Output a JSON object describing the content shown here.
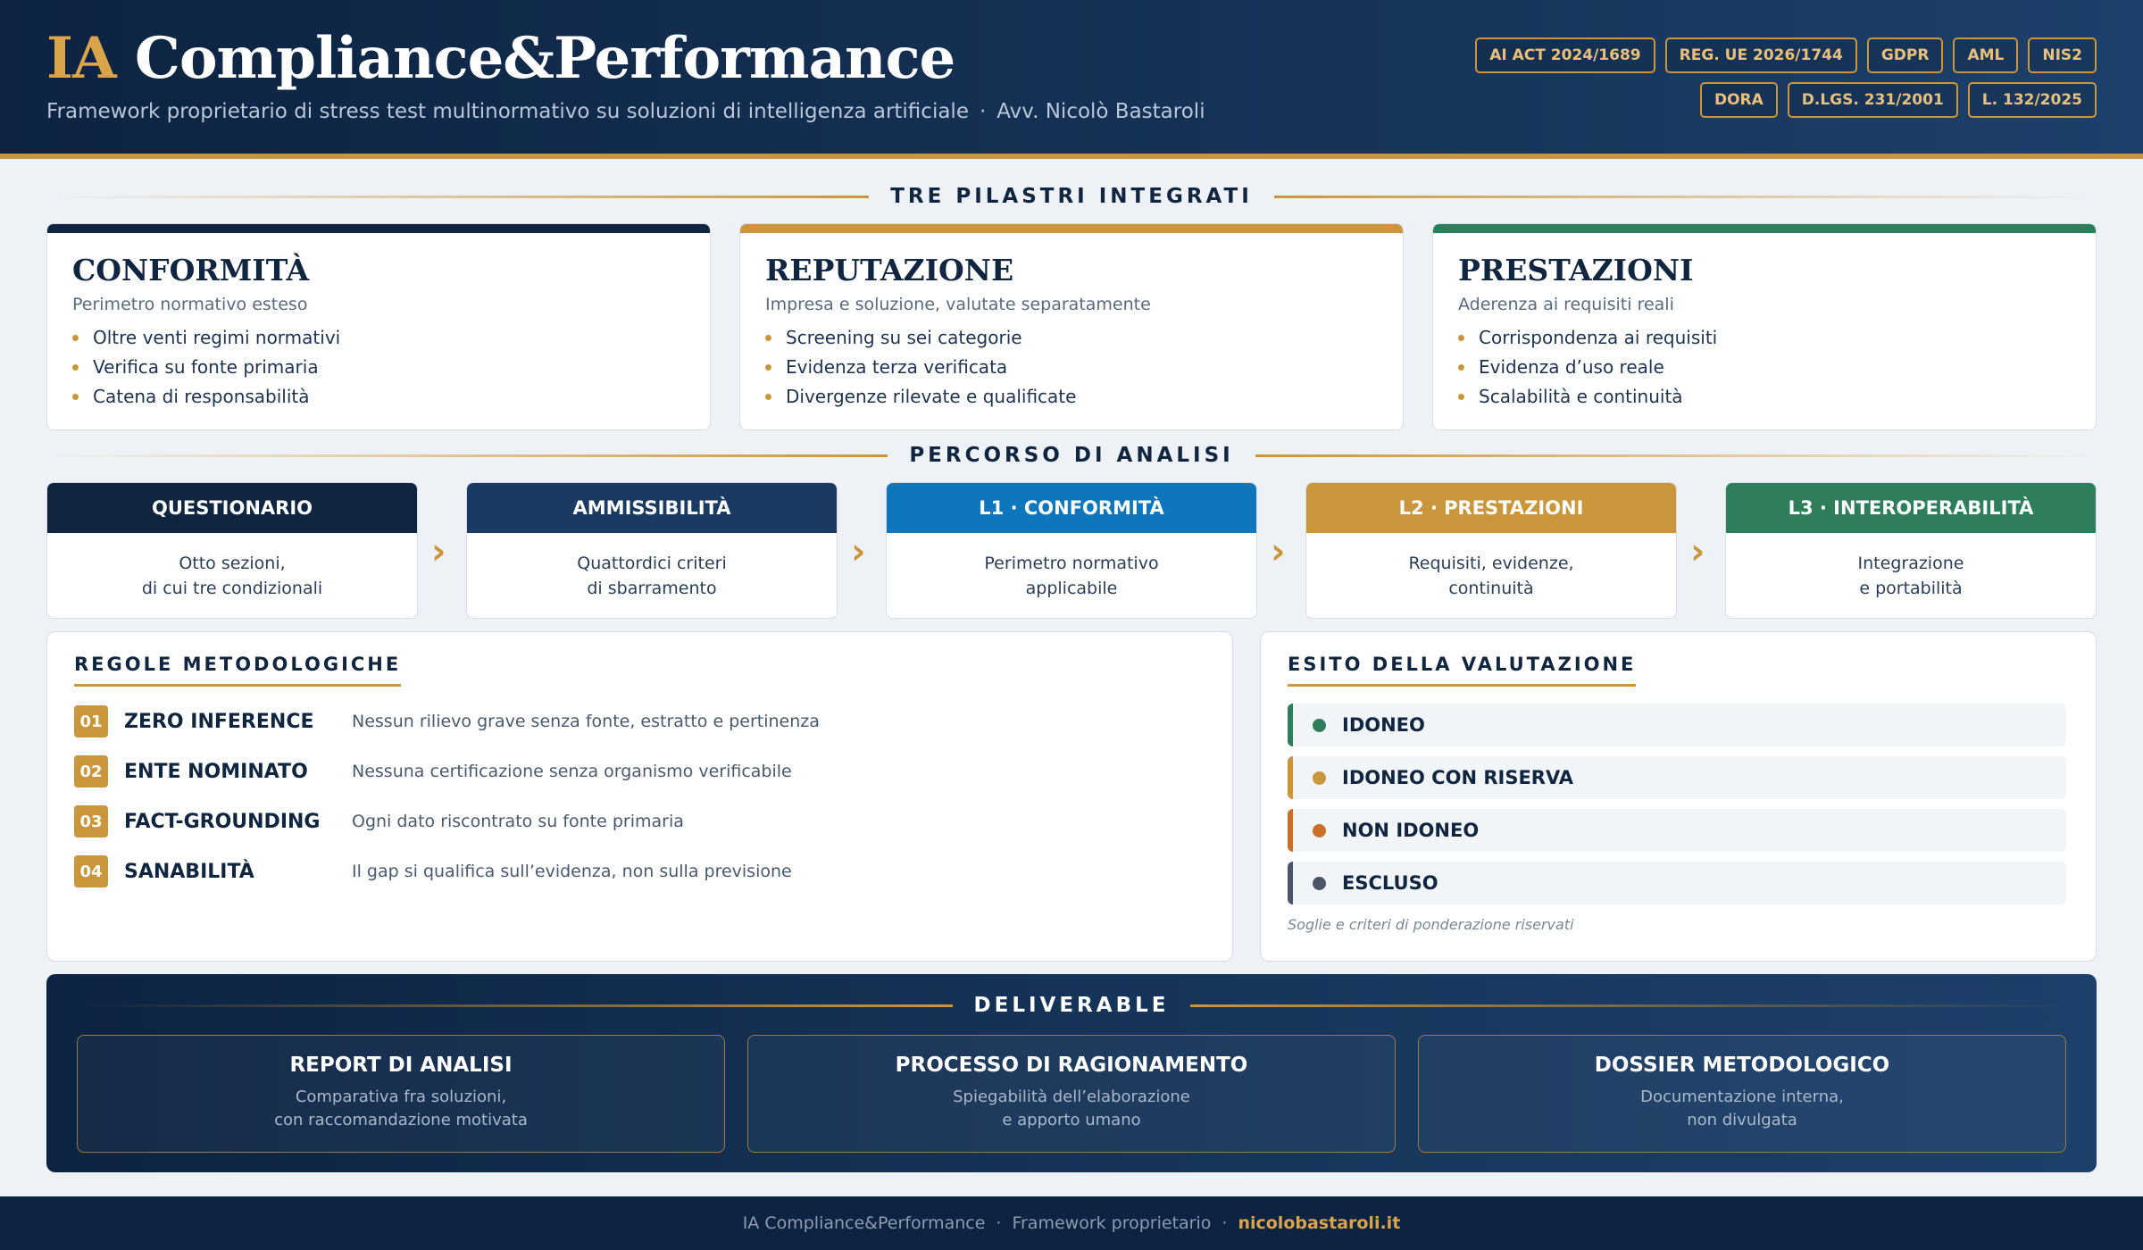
{
  "header": {
    "title_prefix": "IA",
    "title_main": "Compliance&Performance",
    "subtitle": "Framework proprietario di stress test multinormativo su soluzioni di intelligenza artificiale",
    "author": "Avv. Nicolò Bastaroli",
    "separator": "·",
    "badges": [
      "AI ACT 2024/1689",
      "REG. UE 2026/1744",
      "GDPR",
      "AML",
      "NIS2",
      "DORA",
      "D.LGS. 231/2001",
      "L. 132/2025"
    ]
  },
  "pillars_section": {
    "title": "TRE PILASTRI INTEGRATI"
  },
  "pillars": [
    {
      "title": "CONFORMITÀ",
      "subtitle": "Perimetro normativo esteso",
      "color": "#0f2540",
      "items": [
        "Oltre venti regimi normativi",
        "Verifica su fonte primaria",
        "Catena di responsabilità"
      ]
    },
    {
      "title": "REPUTAZIONE",
      "subtitle": "Impresa e soluzione, valutate separatamente",
      "color": "#c9963c",
      "items": [
        "Screening su sei categorie",
        "Evidenza terza verificata",
        "Divergenze rilevate e qualificate"
      ]
    },
    {
      "title": "PRESTAZIONI",
      "subtitle": "Aderenza ai requisiti reali",
      "color": "#2e7d5b",
      "items": [
        "Corrispondenza ai requisiti",
        "Evidenza d’uso reale",
        "Scalabilità e continuità"
      ]
    }
  ],
  "path_section": {
    "title": "PERCORSO DI ANALISI"
  },
  "steps": [
    {
      "title": "QUESTIONARIO",
      "line1": "Otto sezioni,",
      "line2": "di cui tre condizionali",
      "color": "#0f2540"
    },
    {
      "title": "AMMISSIBILITÀ",
      "line1": "Quattordici criteri",
      "line2": "di sbarramento",
      "color": "#1b3a63"
    },
    {
      "title": "L1 · CONFORMITÀ",
      "line1": "Perimetro normativo",
      "line2": "applicabile",
      "color": "#0e76bc"
    },
    {
      "title": "L2 · PRESTAZIONI",
      "line1": "Requisiti, evidenze,",
      "line2": "continuità",
      "color": "#c9963c"
    },
    {
      "title": "L3 · INTEROPERABILITÀ",
      "line1": "Integrazione",
      "line2": "e portabilità",
      "color": "#2e7d5b"
    }
  ],
  "chevron": "›",
  "rules": {
    "title": "REGOLE METODOLOGICHE",
    "items": [
      {
        "num": "01",
        "name": "ZERO INFERENCE",
        "desc": "Nessun rilievo grave senza fonte, estratto e pertinenza"
      },
      {
        "num": "02",
        "name": "ENTE NOMINATO",
        "desc": "Nessuna certificazione senza organismo verificabile"
      },
      {
        "num": "03",
        "name": "FACT-GROUNDING",
        "desc": "Ogni dato riscontrato su fonte primaria"
      },
      {
        "num": "04",
        "name": "SANABILITÀ",
        "desc": "Il gap si qualifica sull’evidenza, non sulla previsione"
      }
    ]
  },
  "outcome": {
    "title": "ESITO DELLA VALUTAZIONE",
    "items": [
      {
        "label": "IDONEO",
        "color": "#2e7d5b"
      },
      {
        "label": "IDONEO CON RISERVA",
        "color": "#c9963c"
      },
      {
        "label": "NON IDONEO",
        "color": "#c8702a"
      },
      {
        "label": "ESCLUSO",
        "color": "#4a5568"
      }
    ],
    "note": "Soglie e criteri di ponderazione riservati"
  },
  "deliverable": {
    "title": "DELIVERABLE",
    "items": [
      {
        "title": "REPORT DI ANALISI",
        "line1": "Comparativa fra soluzioni,",
        "line2": "con raccomandazione motivata"
      },
      {
        "title": "PROCESSO DI RAGIONAMENTO",
        "line1": "Spiegabilità dell’elaborazione",
        "line2": "e apporto umano"
      },
      {
        "title": "DOSSIER METODOLOGICO",
        "line1": "Documentazione interna,",
        "line2": "non divulgata"
      }
    ]
  },
  "footer": {
    "name": "IA Compliance&Performance",
    "label": "Framework proprietario",
    "link": "nicolobastaroli.it",
    "separator": "·"
  }
}
